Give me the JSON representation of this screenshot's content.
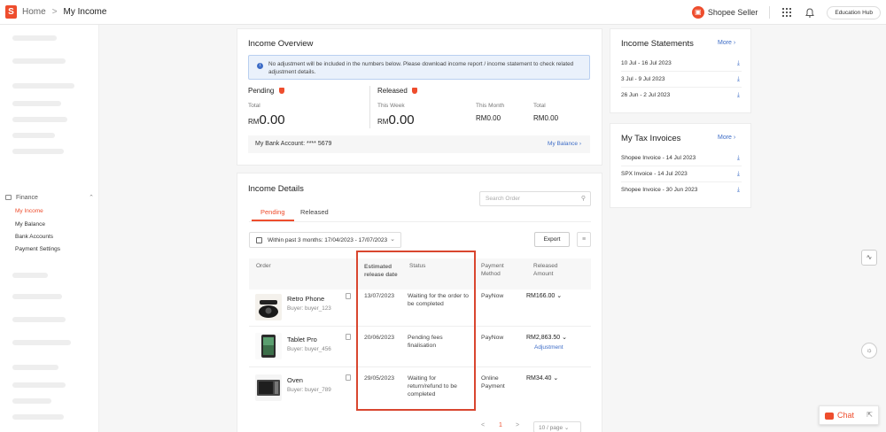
{
  "header": {
    "brand_letter": "S",
    "breadcrumb_home": "Home",
    "breadcrumb_sep": ">",
    "breadcrumb_current": "My Income",
    "seller_label": "Shopee Seller",
    "hub_button": "Education Hub"
  },
  "sidebar": {
    "section": "Finance",
    "items": [
      "My Income",
      "My Balance",
      "Bank Accounts",
      "Payment Settings"
    ]
  },
  "overview": {
    "title": "Income Overview",
    "notice": "No adjustment will be included in the numbers below. Please download income report / income statement to check related adjustment details.",
    "pending_label": "Pending",
    "pending_total_label": "Total",
    "pending_total": "0.00",
    "released_label": "Released",
    "this_week_label": "This Week",
    "this_week_amount": "0.00",
    "this_month_label": "This Month",
    "this_month_amount": "RM0.00",
    "total_label": "Total",
    "total_amount": "RM0.00",
    "currency": "RM",
    "bank_account": "My Bank Account: **** 5679",
    "my_balance_link": "My Balance"
  },
  "details": {
    "title": "Income Details",
    "search_placeholder": "Search Order",
    "tabs": [
      "Pending",
      "Released"
    ],
    "filter": "Within past 3 months:  17/04/2023 - 17/07/2023",
    "export": "Export",
    "columns": {
      "order": "Order",
      "release_date": "Estimated release date",
      "status": "Status",
      "payment": "Payment Method",
      "amount": "Released Amount"
    },
    "rows": [
      {
        "product": "Retro Phone",
        "buyer": "Buyer: buyer_123",
        "date": "13/07/2023",
        "status": "Waiting for the order to be completed",
        "payment": "PayNow",
        "amount": "RM166.00",
        "adjustment": ""
      },
      {
        "product": "Tablet Pro",
        "buyer": "Buyer: buyer_456",
        "date": "20/06/2023",
        "status": "Pending fees finalisation",
        "payment": "PayNow",
        "amount": "RM2,863.50",
        "adjustment": "Adjustment"
      },
      {
        "product": "Oven",
        "buyer": "Buyer: buyer_789",
        "date": "29/05/2023",
        "status": "Waiting for return/refund to be completed",
        "payment": "Online Payment",
        "amount": "RM34.40",
        "adjustment": ""
      }
    ],
    "pagination": {
      "prev": "<",
      "current": "1",
      "next": ">",
      "page_size": "10 / page"
    }
  },
  "statements": {
    "title": "Income Statements",
    "more": "More",
    "items": [
      "10 Jul - 16 Jul 2023",
      "3 Jul - 9 Jul 2023",
      "26 Jun - 2 Jul 2023"
    ]
  },
  "tax": {
    "title": "My Tax Invoices",
    "more": "More",
    "items": [
      "Shopee Invoice - 14 Jul 2023",
      "SPX Invoice - 14 Jul 2023",
      "Shopee Invoice - 30 Jun 2023"
    ]
  },
  "chat": {
    "label": "Chat"
  },
  "colors": {
    "brand": "#ee4d2d",
    "link": "#3e6dc7",
    "highlight": "#d9462f"
  }
}
